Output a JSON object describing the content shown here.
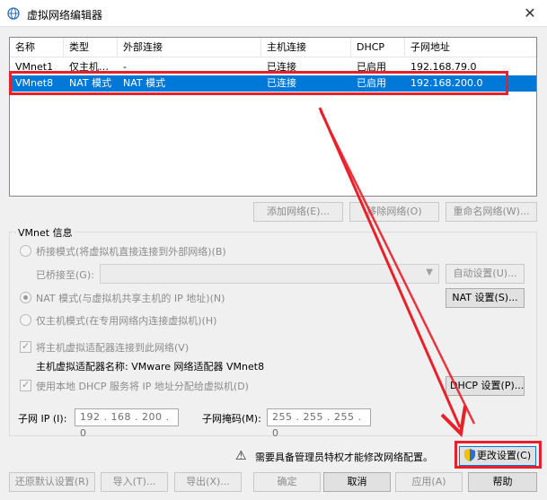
{
  "window": {
    "title": "虚拟网络编辑器",
    "close_glyph": "✕"
  },
  "table": {
    "columns": [
      "名称",
      "类型",
      "外部连接",
      "主机连接",
      "DHCP",
      "子网地址"
    ],
    "rows": [
      [
        "VMnet1",
        "仅主机…",
        "-",
        "已连接",
        "已启用",
        "192.168.79.0"
      ],
      [
        "VMnet8",
        "NAT 模式",
        "NAT 模式",
        "已连接",
        "已启用",
        "192.168.200.0"
      ]
    ],
    "selected_row": 1
  },
  "list_buttons": {
    "add": "添加网络(E)...",
    "remove": "移除网络(O)",
    "rename": "重命名网络(W)..."
  },
  "vmnet_info": {
    "title": "VMnet 信息",
    "bridged": "桥接模式(将虚拟机直接连接到外部网络)(B)",
    "bridged_to_label": "已桥接至(G):",
    "auto_settings": "自动设置(U)...",
    "nat": "NAT 模式(与虚拟机共享主机的 IP 地址)(N)",
    "nat_settings": "NAT 设置(S)...",
    "host_only": "仅主机模式(在专用网络内连接虚拟机)(H)",
    "connect_adapter": "将主机虚拟适配器连接到此网络(V)",
    "adapter_name_label": "主机虚拟适配器名称: VMware 网络适配器 VMnet8",
    "use_dhcp": "使用本地 DHCP 服务将 IP 地址分配给虚拟机(D)",
    "dhcp_settings": "DHCP 设置(P)...",
    "subnet_ip_label": "子网 IP (I):",
    "subnet_ip": "192 . 168 . 200 . 0",
    "subnet_mask_label": "子网掩码(M):",
    "subnet_mask": "255 . 255 . 255 . 0"
  },
  "admin": {
    "message": "需要具备管理员特权才能修改网络配置。",
    "change_settings": "更改设置(C)"
  },
  "footer": {
    "restore": "还原默认设置(R)",
    "import": "导入(T)...",
    "export": "导出(X)...",
    "ok": "确定",
    "cancel": "取消",
    "apply": "应用(A)",
    "help": "帮助"
  },
  "colors": {
    "selection": "#0078d7",
    "annotation": "#e8202a"
  }
}
